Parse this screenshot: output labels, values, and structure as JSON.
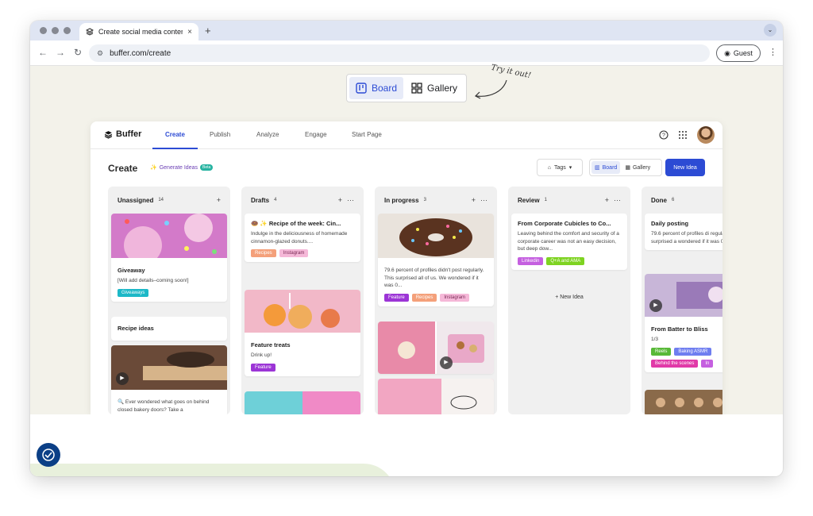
{
  "browser": {
    "tab_title": "Create social media content f",
    "tab_close": "×",
    "new_tab": "+",
    "url": "buffer.com/create",
    "guest_label": "Guest"
  },
  "promo": {
    "board_label": "Board",
    "gallery_label": "Gallery",
    "try_label": "Try it out!"
  },
  "app": {
    "brand": "Buffer",
    "nav": [
      "Create",
      "Publish",
      "Analyze",
      "Engage",
      "Start Page"
    ],
    "page_title": "Create",
    "generate_label": "Generate Ideas",
    "beta_label": "Beta",
    "tags_label": "Tags",
    "board_label": "Board",
    "gallery_label": "Gallery",
    "new_idea_label": "New Idea"
  },
  "columns": [
    {
      "name": "Unassigned",
      "count": "14",
      "cards": [
        {
          "title": "Giveaway",
          "text": "[Will add details–coming soon!]",
          "tags": [
            {
              "label": "Giveaways",
              "bg": "#1cb8c7",
              "fg": "#ffffff"
            }
          ]
        },
        {
          "title": "Recipe ideas"
        },
        {
          "text": "🔍 Ever wondered what goes on behind closed bakery doors? Take a"
        }
      ]
    },
    {
      "name": "Drafts",
      "count": "4",
      "cards": [
        {
          "title": "🍩 ✨ Recipe of the week: Cin...",
          "text": "Indulge in the deliciousness of homemade cinnamon-glazed donuts....",
          "tags": [
            {
              "label": "Recipes",
              "bg": "#f4a07a",
              "fg": "#ffffff"
            },
            {
              "label": "Instagram",
              "bg": "#f5b8d8",
              "fg": "#7a2a55"
            }
          ]
        },
        {
          "title": "Feature treats",
          "text": "Drink up!",
          "tags": [
            {
              "label": "Feature",
              "bg": "#9c35d6",
              "fg": "#ffffff"
            }
          ]
        }
      ]
    },
    {
      "name": "In progress",
      "count": "3",
      "cards": [
        {
          "text": "79.6 percent of profiles didn't post regularly. This surprised all of us. We wondered if it was 0...",
          "tags": [
            {
              "label": "Feature",
              "bg": "#9c35d6",
              "fg": "#ffffff"
            },
            {
              "label": "Recipes",
              "bg": "#f4a07a",
              "fg": "#ffffff"
            },
            {
              "label": "Instagram",
              "bg": "#f5b8d8",
              "fg": "#7a2a55"
            }
          ]
        }
      ]
    },
    {
      "name": "Review",
      "count": "1",
      "new_idea_label": "+ New Idea",
      "cards": [
        {
          "title": "From Corporate Cubicles to Co...",
          "text": "Leaving behind the comfort and security of a corporate career was not an easy decision, but deep dow...",
          "tags": [
            {
              "label": "Linkedin",
              "bg": "#c560e0",
              "fg": "#ffffff"
            },
            {
              "label": "Q+A and AMA",
              "bg": "#7ed321",
              "fg": "#ffffff"
            }
          ]
        }
      ]
    },
    {
      "name": "Done",
      "count": "6",
      "cards": [
        {
          "title": "Daily posting",
          "text": "79.6 percent of profiles di regularly. This surprised a wondered if it was 0...",
          "tags": []
        },
        {
          "title": "From Batter to Bliss",
          "text": "1/3",
          "tags": [
            {
              "label": "Reels",
              "bg": "#58b938",
              "fg": "#ffffff"
            },
            {
              "label": "Baking ASMR",
              "bg": "#6f7ef0",
              "fg": "#ffffff"
            },
            {
              "label": "Behind the scenes",
              "bg": "#e13aa8",
              "fg": "#ffffff"
            },
            {
              "label": "In",
              "bg": "#c560e0",
              "fg": "#ffffff"
            }
          ]
        }
      ]
    }
  ],
  "colors": {
    "accent": "#2c4bd4",
    "background": "#f3f2ea"
  }
}
